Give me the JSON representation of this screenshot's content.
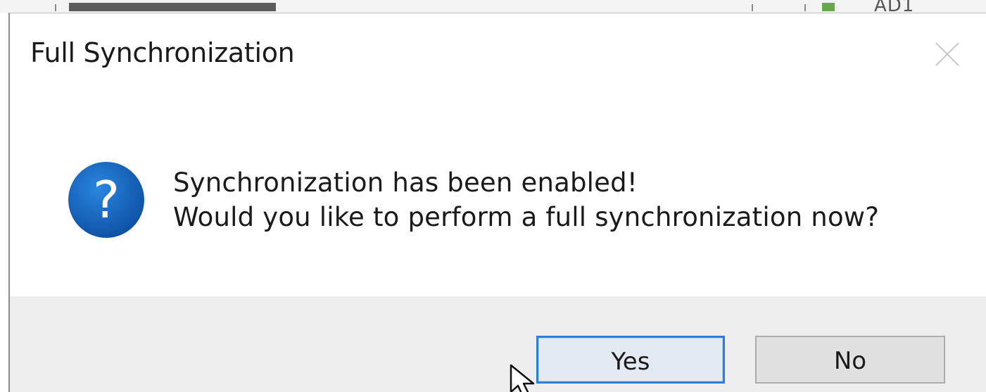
{
  "background_app": {
    "corner_label": "AD1"
  },
  "dialog": {
    "title": "Full Synchronization",
    "icon": "question-icon",
    "message_line1": "Synchronization has been enabled!",
    "message_line2": "Would you like to perform a full synchronization now?",
    "buttons": {
      "yes_label": "Yes",
      "no_label": "No"
    },
    "default_button": "Yes"
  },
  "colors": {
    "icon_blue": "#1565c0",
    "focus_border": "#2a7fdd",
    "footer_bg": "#eeeeee"
  }
}
